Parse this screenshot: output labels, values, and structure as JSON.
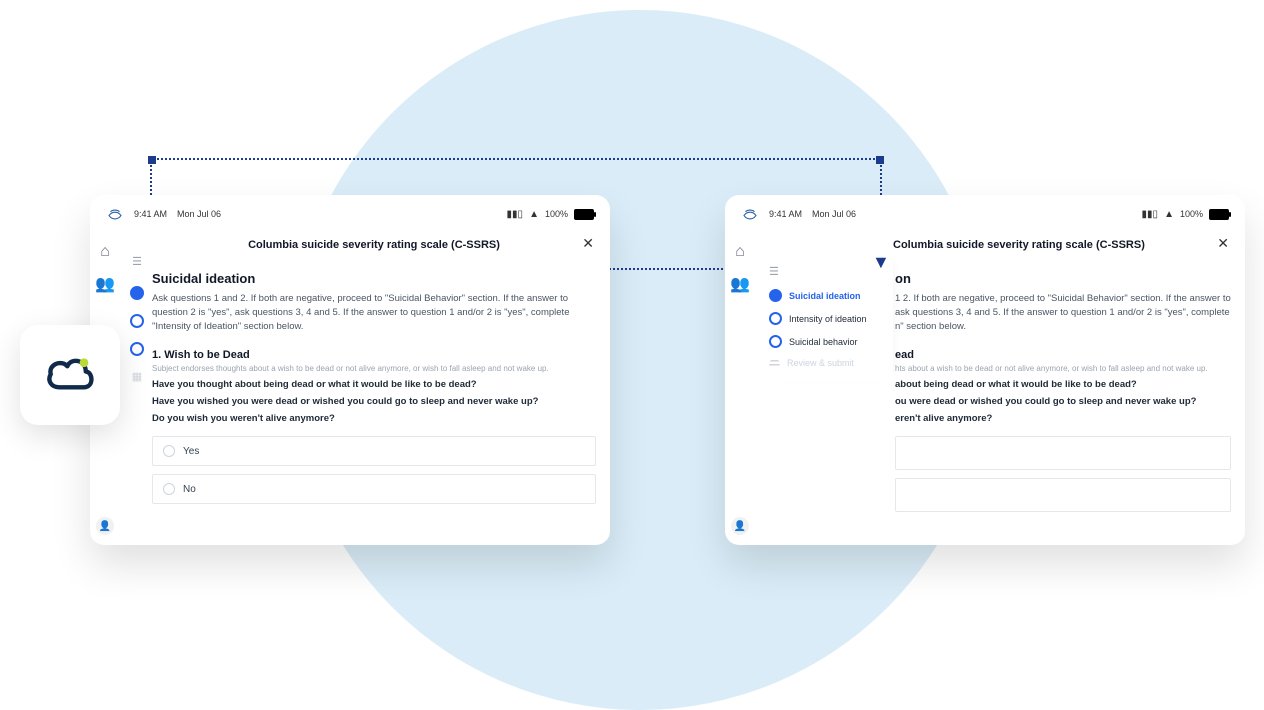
{
  "status": {
    "time": "9:41 AM",
    "date": "Mon Jul 06",
    "battery": "100%"
  },
  "form": {
    "title": "Columbia suicide severity rating scale (C-SSRS)",
    "section": "Suicidal ideation",
    "instructions": "Ask questions 1 and 2.  If both are negative, proceed to \"Suicidal Behavior\" section. If the answer to question 2 is \"yes\", ask questions 3, 4 and 5.  If the answer to question 1 and/or 2 is \"yes\", complete \"Intensity of Ideation\" section below.",
    "q1": {
      "heading": "1. Wish to be Dead",
      "sub": "Subject endorses thoughts about a wish to be dead or not alive anymore, or wish to fall asleep and not wake up.",
      "line1": "Have you thought about being dead or what it would be like to be dead?",
      "line2": "Have you wished you were dead or wished you could go to sleep and never wake up?",
      "line3": "Do you wish you weren't alive anymore?",
      "opt_yes": "Yes",
      "opt_no": "No"
    }
  },
  "right_clip": {
    "section_tail": "on",
    "instr_l1": "1 2.  If both are negative, proceed to \"Suicidal Behavior\" section. If the answer to",
    "instr_l2": "ask questions 3, 4 and 5.  If the answer to question 1 and/or 2 is \"yes\", complete",
    "instr_l3": "n\" section below.",
    "q_tail": "ead",
    "sub_tail": "hts about a wish to be dead or not alive anymore, or wish to fall asleep and not wake up.",
    "l1_tail": "about being dead or what it would be like to be dead?",
    "l2_tail": "ou were dead or wished you could go to sleep and never wake up?",
    "l3_tail": "eren't alive anymore?"
  },
  "nav": {
    "item1": "Suicidal ideation",
    "item2": "Intensity of ideation",
    "item3": "Suicidal behavior",
    "item4": "Review & submit"
  }
}
